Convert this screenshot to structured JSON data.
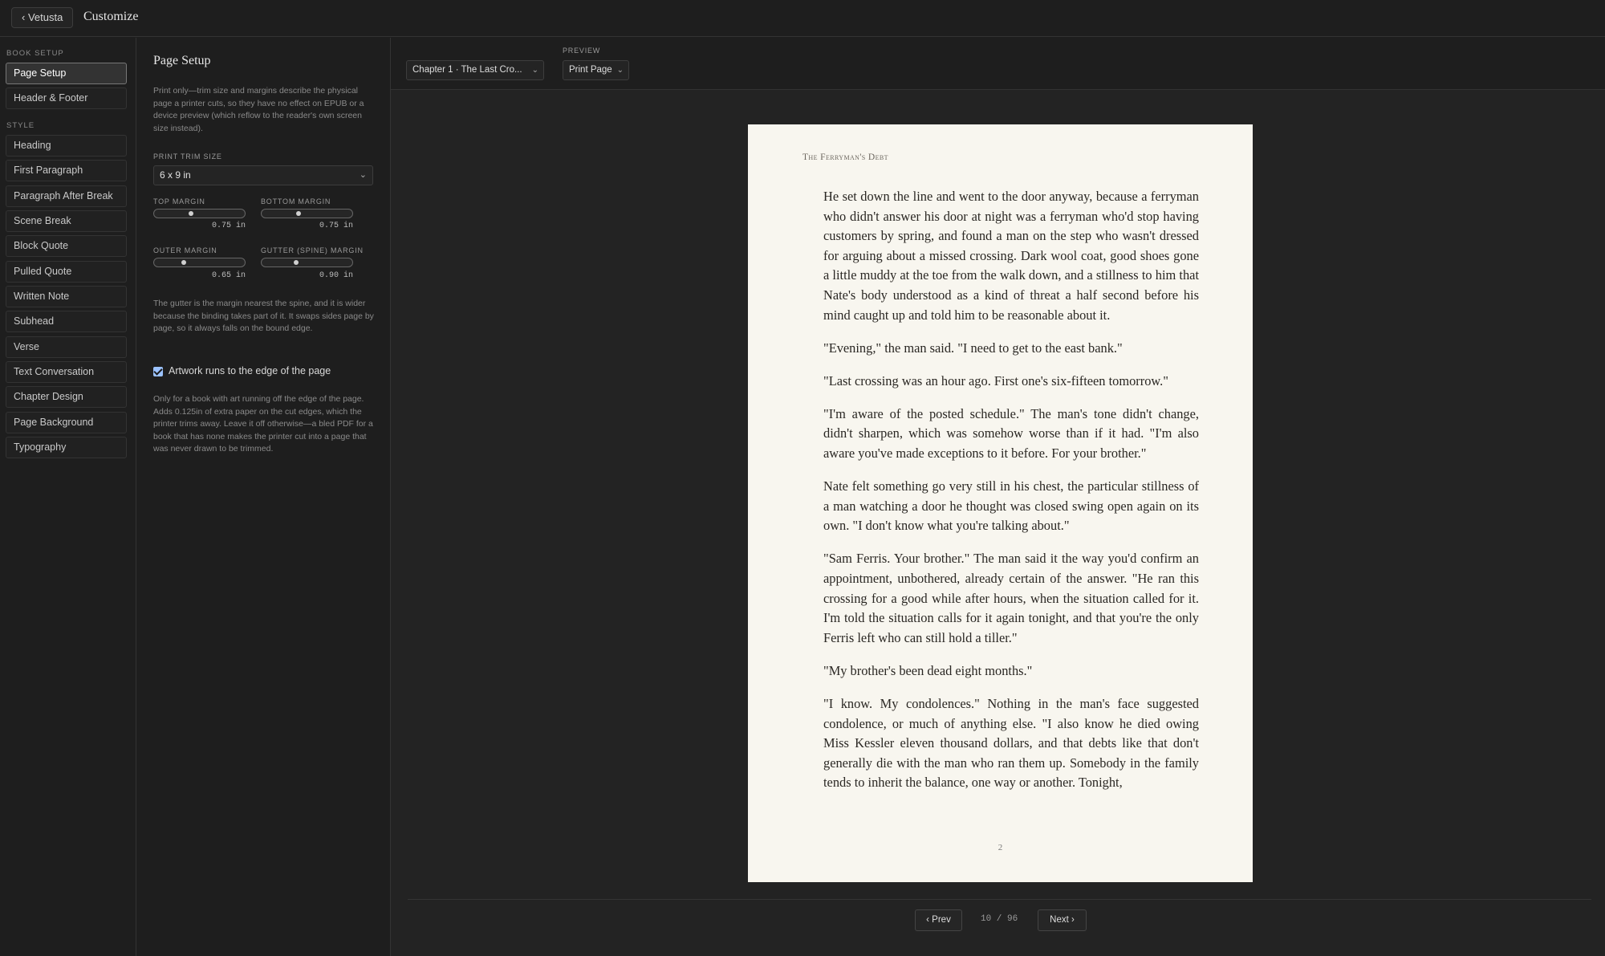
{
  "topbar": {
    "back_label": "‹ Vetusta",
    "title": "Customize"
  },
  "nav": {
    "book_setup_label": "BOOK SETUP",
    "book_setup_items": [
      "Page Setup",
      "Header & Footer"
    ],
    "style_label": "STYLE",
    "style_items": [
      "Heading",
      "First Paragraph",
      "Paragraph After Break",
      "Scene Break",
      "Block Quote",
      "Pulled Quote",
      "Written Note",
      "Subhead",
      "Verse",
      "Text Conversation",
      "Chapter Design",
      "Page Background",
      "Typography"
    ],
    "active": "Page Setup"
  },
  "panel": {
    "title": "Page Setup",
    "intro": "Print only—trim size and margins describe the physical page a printer cuts, so they have no effect on EPUB or a device preview (which reflow to the reader's own screen size instead).",
    "trim_label": "PRINT TRIM SIZE",
    "trim_value": "6 x 9 in",
    "top_margin": {
      "label": "TOP MARGIN",
      "value": "0.75 in",
      "level": 0.4
    },
    "bottom_margin": {
      "label": "BOTTOM MARGIN",
      "value": "0.75 in",
      "level": 0.4
    },
    "outer_margin": {
      "label": "OUTER MARGIN",
      "value": "0.65 in",
      "level": 0.32
    },
    "gutter_margin": {
      "label": "GUTTER (SPINE) MARGIN",
      "value": "0.90 in",
      "level": 0.37
    },
    "gutter_help": "The gutter is the margin nearest the spine, and it is wider because the binding takes part of it. It swaps sides page by page, so it always falls on the bound edge.",
    "bleed_label": "Artwork runs to the edge of the page",
    "bleed_checked": true,
    "bleed_help": "Only for a book with art running off the edge of the page. Adds 0.125in of extra paper on the cut edges, which the printer trims away. Leave it off otherwise—a bled PDF for a book that has none makes the printer cut into a page that was never drawn to be trimmed."
  },
  "preview": {
    "chapter_select": "Chapter 1 · The Last Cro...",
    "preview_label": "PREVIEW",
    "mode_select": "Print Page",
    "running_head": "The Ferryman's Debt",
    "paragraphs": [
      "He set down the line and went to the door anyway, because a ferryman who didn't answer his door at night was a ferryman who'd stop having customers by spring, and found a man on the step who wasn't dressed for arguing about a missed crossing. Dark wool coat, good shoes gone a little muddy at the toe from the walk down, and a stillness to him that Nate's body understood as a kind of threat a half second before his mind caught up and told him to be reasonable about it.",
      "\"Evening,\" the man said. \"I need to get to the east bank.\"",
      "\"Last crossing was an hour ago. First one's six-fifteen tomorrow.\"",
      "\"I'm aware of the posted schedule.\" The man's tone didn't change, didn't sharpen, which was somehow worse than if it had. \"I'm also aware you've made exceptions to it before. For your brother.\"",
      "Nate felt something go very still in his chest, the particular stillness of a man watching a door he thought was closed swing open again on its own. \"I don't know what you're talking about.\"",
      "\"Sam Ferris. Your brother.\" The man said it the way you'd confirm an appointment, unbothered, already certain of the answer. \"He ran this crossing for a good while after hours, when the situation called for it. I'm told the situation calls for it again tonight, and that you're the only Ferris left who can still hold a tiller.\"",
      "\"My brother's been dead eight months.\"",
      "\"I know. My condolences.\" Nothing in the man's face suggested condolence, or much of anything else. \"I also know he died owing Miss Kessler eleven thousand dollars, and that debts like that don't generally die with the man who ran them up. Somebody in the family tends to inherit the balance, one way or another. Tonight,"
    ],
    "folio": "2",
    "prev_label": "‹ Prev",
    "page_count": "10 / 96",
    "next_label": "Next ›"
  }
}
